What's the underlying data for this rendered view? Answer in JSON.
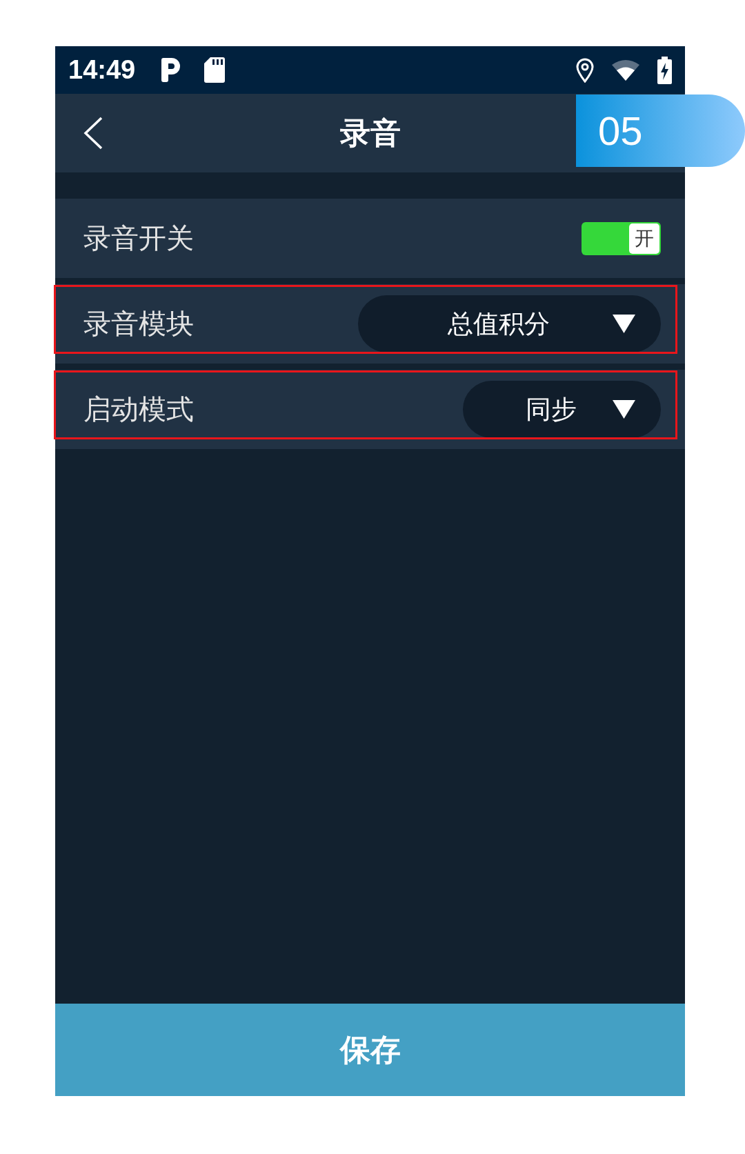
{
  "status_bar": {
    "time": "14:49"
  },
  "header": {
    "title": "录音"
  },
  "step_badge": "05",
  "settings": [
    {
      "kind": "toggle",
      "label": "录音开关",
      "on": true,
      "knob_label": "开",
      "highlighted": false
    },
    {
      "kind": "dropdown",
      "label": "录音模块",
      "value": "总值积分",
      "highlighted": true
    },
    {
      "kind": "dropdown",
      "label": "启动模式",
      "value": "同步",
      "highlighted": true
    }
  ],
  "save_button": "保存"
}
